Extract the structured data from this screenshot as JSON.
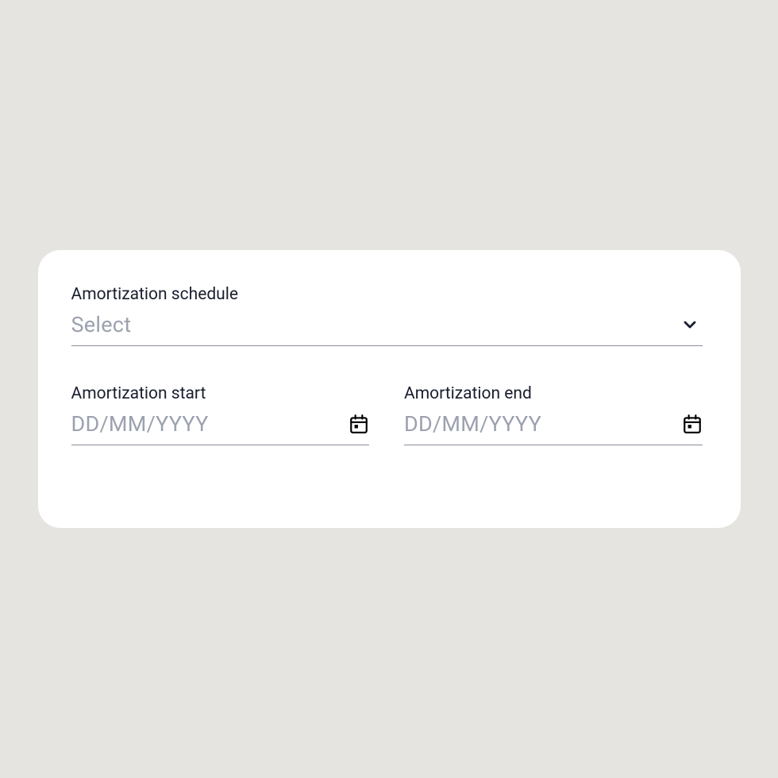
{
  "schedule": {
    "label": "Amortization schedule",
    "placeholder": "Select",
    "value": ""
  },
  "amortization_start": {
    "label": "Amortization start",
    "placeholder": "DD/MM/YYYY",
    "value": ""
  },
  "amortization_end": {
    "label": "Amortization end",
    "placeholder": "DD/MM/YYYY",
    "value": ""
  }
}
